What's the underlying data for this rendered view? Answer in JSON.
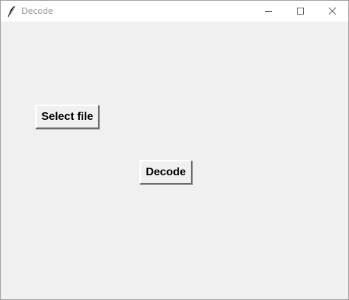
{
  "window": {
    "title": "Decode",
    "icon": "feather-icon",
    "controls": {
      "minimize_icon": "minimize-icon",
      "maximize_icon": "maximize-icon",
      "close_icon": "close-icon"
    }
  },
  "main": {
    "select_file_label": "Select file",
    "decode_label": "Decode"
  },
  "colors": {
    "background": "#f0f0f0",
    "titlebar": "#ffffff",
    "title_text": "#9b9b9b"
  }
}
